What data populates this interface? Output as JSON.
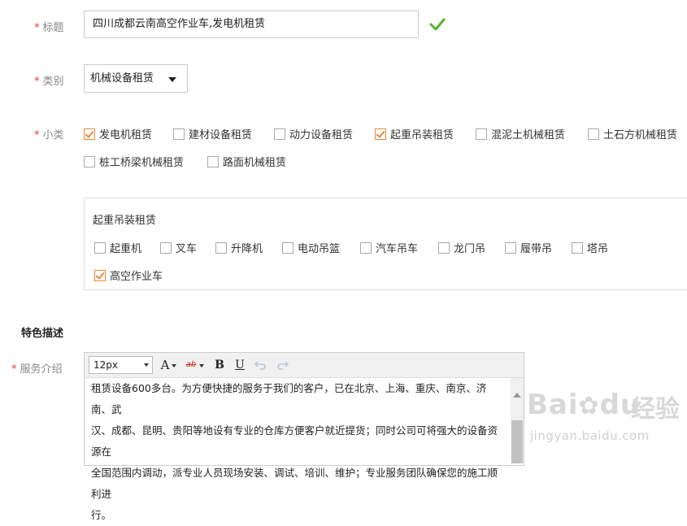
{
  "form": {
    "title_field": {
      "required_mark": "*",
      "label": "标题",
      "value": "四川成都云南高空作业车,发电机租赁"
    },
    "category_field": {
      "required_mark": "*",
      "label": "类别",
      "selected": "机械设备租赁"
    },
    "subcategory_field": {
      "required_mark": "*",
      "label": "小类",
      "options": [
        {
          "label": "发电机租赁",
          "checked": true
        },
        {
          "label": "建材设备租赁",
          "checked": false
        },
        {
          "label": "动力设备租赁",
          "checked": false
        },
        {
          "label": "起重吊装租赁",
          "checked": true
        },
        {
          "label": "混泥土机械租赁",
          "checked": false
        },
        {
          "label": "土石方机械租赁",
          "checked": false
        },
        {
          "label": "桩工桥梁机械租赁",
          "checked": false
        },
        {
          "label": "路面机械租赁",
          "checked": false
        }
      ]
    },
    "sub_panel": {
      "title": "起重吊装租赁",
      "options": [
        {
          "label": "起重机",
          "checked": false
        },
        {
          "label": "叉车",
          "checked": false
        },
        {
          "label": "升降机",
          "checked": false
        },
        {
          "label": "电动吊篮",
          "checked": false
        },
        {
          "label": "汽车吊车",
          "checked": false
        },
        {
          "label": "龙门吊",
          "checked": false
        },
        {
          "label": "履带吊",
          "checked": false
        },
        {
          "label": "塔吊",
          "checked": false
        },
        {
          "label": "高空作业车",
          "checked": true
        }
      ]
    },
    "section_title": "特色描述",
    "service_field": {
      "required_mark": "*",
      "label": "服务介绍",
      "toolbar": {
        "font_size": "12px",
        "font_icon": "A",
        "bold": "B",
        "underline": "U",
        "highlight": "ab"
      },
      "content_lines": [
        "租赁设备600多台。为方便快捷的服务于我们的客户，已在北京、上海、重庆、南京、济南、武",
        "汉、成都、昆明、贵阳等地设有专业的仓库方便客户就近提货；同时公司可将强大的设备资源在",
        "全国范围内调动，派专业人员现场安装、调试、培训、维护；专业服务团队确保您的施工顺利进",
        "行。"
      ]
    }
  },
  "colors": {
    "required": "#e4393c",
    "checked": "#e8883a",
    "valid": "#52b52a"
  },
  "watermark": {
    "logo": "Bai",
    "logo_tail": "du",
    "cn": "经验",
    "url": "jingyan.baidu.com"
  }
}
